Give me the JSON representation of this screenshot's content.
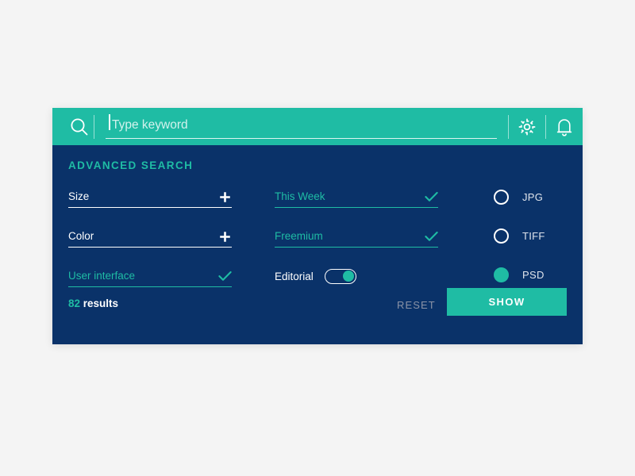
{
  "theme": {
    "page_background": "#f4f4f4",
    "accent_teal": "#1fbca4",
    "panel_navy": "#0a3269",
    "text_white": "#ffffff",
    "muted_text": "#8a93a6"
  },
  "search_bar": {
    "search_icon": "search-icon",
    "keyword_placeholder": "Type keyword",
    "keyword_value": "",
    "settings_icon": "gear-icon",
    "notifications_icon": "bell-icon"
  },
  "panel": {
    "title": "ADVANCED SEARCH",
    "left_column": [
      {
        "label": "Size",
        "state": "unselected",
        "action_icon": "plus-icon",
        "name": "size"
      },
      {
        "label": "Color",
        "state": "unselected",
        "action_icon": "plus-icon",
        "name": "color"
      },
      {
        "label": "User interface",
        "state": "selected",
        "action_icon": "check-icon",
        "name": "user-interface"
      }
    ],
    "middle_column": [
      {
        "label": "This Week",
        "state": "selected",
        "action_icon": "check-icon",
        "name": "this-week"
      },
      {
        "label": "Freemium",
        "state": "selected",
        "action_icon": "check-icon",
        "name": "freemium"
      }
    ],
    "toggle": {
      "label": "Editorial",
      "value": "on"
    },
    "formats": [
      {
        "label": "JPG",
        "selected": false,
        "name": "jpg"
      },
      {
        "label": "TIFF",
        "selected": false,
        "name": "tiff"
      },
      {
        "label": "PSD",
        "selected": true,
        "name": "psd"
      }
    ]
  },
  "footer": {
    "results_number": "82",
    "results_word": " results",
    "reset_label": "RESET",
    "show_label": "SHOW"
  }
}
